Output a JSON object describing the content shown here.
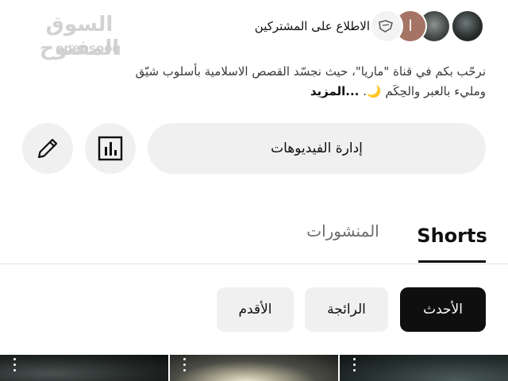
{
  "watermark": {
    "main": "السوق المفتوح",
    "sub": "opensooq"
  },
  "subscribers": {
    "label": "الاطلاع على المشتركين",
    "avatar_letter": "ا"
  },
  "description": {
    "line1": "نرحّب بكم في قناة \"ماريا\"، حيث نجسّد القصص الاسلامية بأسلوب شيّق",
    "line2": "ومليء بالعبر والحِكَم 🌙. ",
    "more": "...المزيد"
  },
  "actions": {
    "manage_videos": "إدارة الفيديوهات"
  },
  "tabs": {
    "shorts": "Shorts",
    "posts": "المنشورات"
  },
  "chips": {
    "newest": "الأحدث",
    "popular": "الرائجة",
    "oldest": "الأقدم"
  },
  "colors": {
    "chip_active_bg": "#0f0f0f",
    "chip_bg": "#f0f0f0",
    "text": "#0f0f0f"
  },
  "icons": {
    "edit": "pencil-icon",
    "stats": "bar-chart-icon",
    "thumb_menu": "more-vertical-icon"
  }
}
